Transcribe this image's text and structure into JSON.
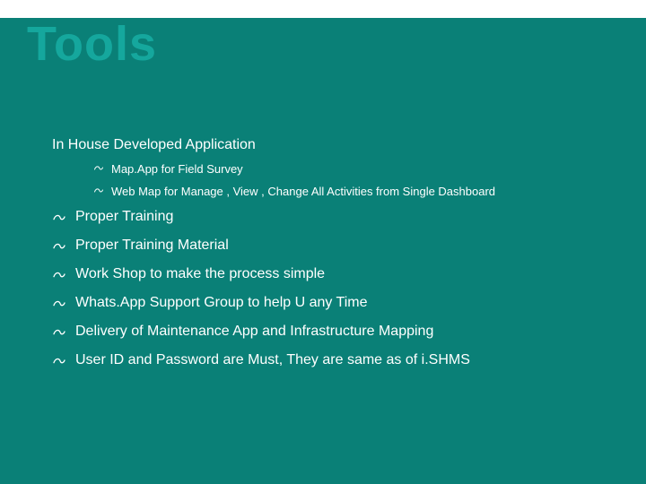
{
  "colors": {
    "band": "#0a8077",
    "title": "#15a79d",
    "text": "#ffffff"
  },
  "title": "Tools",
  "intro": "In House Developed Application",
  "sub_items": [
    "Map.App  for Field Survey",
    "Web Map for Manage , View , Change  All Activities from Single Dashboard"
  ],
  "main_items": [
    "Proper Training",
    "Proper Training Material",
    "Work Shop to make the process simple",
    "Whats.App Support Group to help U any Time",
    "Delivery of Maintenance App and Infrastructure  Mapping",
    "User ID and Password are Must, They are same as of i.SHMS"
  ]
}
